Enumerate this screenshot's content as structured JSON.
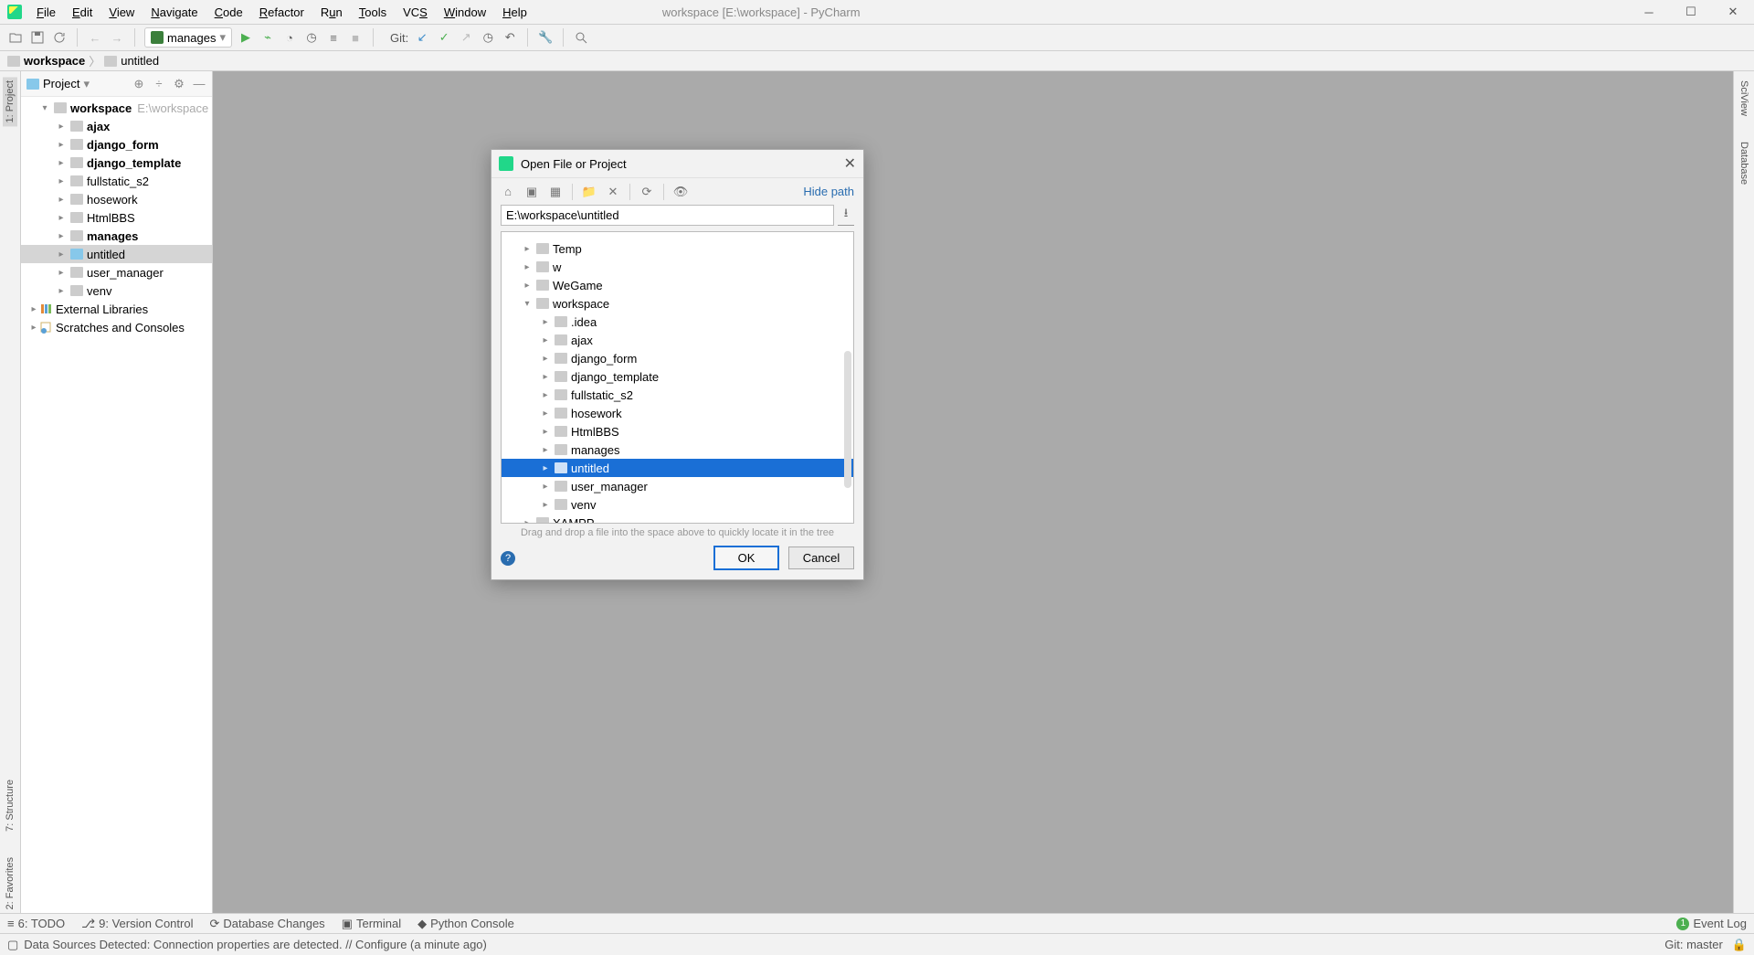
{
  "app": {
    "title": "workspace [E:\\workspace] - PyCharm",
    "menu": [
      "File",
      "Edit",
      "View",
      "Navigate",
      "Code",
      "Refactor",
      "Run",
      "Tools",
      "VCS",
      "Window",
      "Help"
    ]
  },
  "toolbar": {
    "run_config": "manages",
    "git_label": "Git:"
  },
  "breadcrumb": {
    "root": "workspace",
    "child": "untitled"
  },
  "left_gutter": {
    "project": "1: Project"
  },
  "right_gutter": {
    "sciview": "SciView",
    "database": "Database"
  },
  "bottom_gutter": {
    "structure": "7: Structure",
    "favorites": "2: Favorites"
  },
  "project_pane": {
    "title": "Project",
    "root": {
      "name": "workspace",
      "path": "E:\\workspace"
    },
    "children": [
      "ajax",
      "django_form",
      "django_template",
      "fullstatic_s2",
      "hosework",
      "HtmlBBS",
      "manages",
      "untitled",
      "user_manager",
      "venv"
    ],
    "bold_children": [
      "ajax",
      "django_form",
      "django_template",
      "manages"
    ],
    "selected": "untitled",
    "ext_libs": "External Libraries",
    "scratches": "Scratches and Consoles"
  },
  "bottom_tabs": {
    "todo": "6: TODO",
    "version_control": "9: Version Control",
    "db_changes": "Database Changes",
    "terminal": "Terminal",
    "python_console": "Python Console",
    "event_log": "Event Log",
    "event_count": "1"
  },
  "statusbar": {
    "message": "Data Sources Detected: Connection properties are detected. // Configure (a minute ago)",
    "git": "Git: master"
  },
  "dialog": {
    "title": "Open File or Project",
    "hide_path": "Hide path",
    "path_value": "E:\\workspace\\untitled",
    "tree_l0": [
      "Temp",
      "w",
      "WeGame",
      "workspace"
    ],
    "tree_workspace_children": [
      ".idea",
      "ajax",
      "django_form",
      "django_template",
      "fullstatic_s2",
      "hosework",
      "HtmlBBS",
      "manages",
      "untitled",
      "user_manager",
      "venv"
    ],
    "tree_l0_after": [
      "XAMPP"
    ],
    "selected": "untitled",
    "hint": "Drag and drop a file into the space above to quickly locate it in the tree",
    "ok": "OK",
    "cancel": "Cancel"
  }
}
